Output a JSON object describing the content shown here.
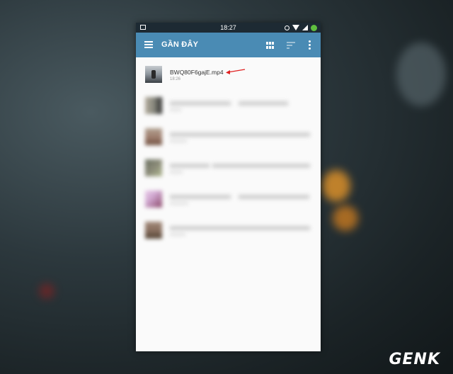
{
  "status_bar": {
    "time": "18:27"
  },
  "toolbar": {
    "title": "GẦN ĐÂY"
  },
  "files": [
    {
      "name": "BWQ80F6gajE.mp4",
      "time": "18:26"
    }
  ],
  "blurred_rows": [
    {
      "thumb_top": "#8a8a80",
      "thumb_bottom": "#2a2a2a"
    },
    {
      "thumb_top": "#a09080",
      "thumb_bottom": "#705040"
    },
    {
      "thumb_top": "#6a7060",
      "thumb_bottom": "#b0b890"
    },
    {
      "thumb_top": "#d0a8d0",
      "thumb_bottom": "#884466"
    },
    {
      "thumb_top": "#8a7060",
      "thumb_bottom": "#504030"
    }
  ],
  "watermark": {
    "text": "GENK"
  },
  "colors": {
    "toolbar": "#4a8bb4",
    "status_bar": "#1d2a33",
    "arrow": "#e02020"
  }
}
